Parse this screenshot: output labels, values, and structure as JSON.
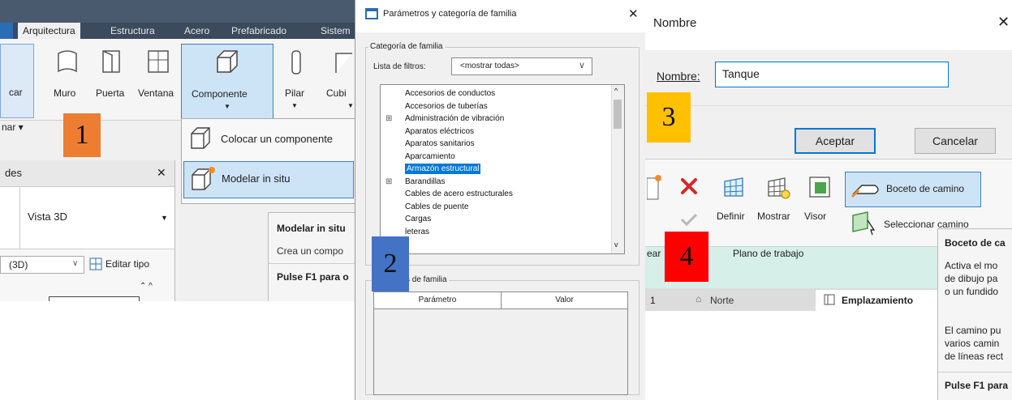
{
  "panel1": {
    "tabs": [
      "Arquitectura",
      "Estructura",
      "Acero",
      "Prefabricado",
      "Sistem"
    ],
    "left_edge_text": "car",
    "left_edge_text2": "nar ▾",
    "ribbon_buttons": [
      "Muro",
      "Puerta",
      "Ventana",
      "Componente",
      "Pilar",
      "Cubi"
    ],
    "menu": {
      "place_component": "Colocar un componente",
      "model_in_place": "Modelar in situ"
    },
    "tooltip": {
      "title": "Modelar in situ",
      "desc": "Crea un compo",
      "help": "Pulse F1 para o"
    },
    "properties": {
      "header": "des",
      "close": "✕",
      "view_name": "Vista 3D",
      "dropdown_value": "(3D)",
      "edit_type": "Editar tipo"
    },
    "badge": "1",
    "badge_color": "#ed7d31"
  },
  "panel2": {
    "title": "Parámetros y categoría de familia",
    "close": "✕",
    "group_category": "Categoría de familia",
    "filter_label": "Lista de filtros:",
    "filter_value": "<mostrar todas>",
    "categories": [
      {
        "label": "Accesorios de conductos",
        "expand": false
      },
      {
        "label": "Accesorios de tuberías",
        "expand": false
      },
      {
        "label": "Administración de vibración",
        "expand": true
      },
      {
        "label": "Aparatos eléctricos",
        "expand": false
      },
      {
        "label": "Aparatos sanitarios",
        "expand": false
      },
      {
        "label": "Aparcamiento",
        "expand": false
      },
      {
        "label": "Armazón estructural",
        "expand": false,
        "selected": true
      },
      {
        "label": "Barandillas",
        "expand": true
      },
      {
        "label": "Cables de acero estructurales",
        "expand": false
      },
      {
        "label": "Cables de puente",
        "expand": false
      },
      {
        "label": "Cargas",
        "expand": false
      },
      {
        "label": "leteras",
        "expand": false
      }
    ],
    "group_params": "s de familia",
    "col_param": "Parámetro",
    "col_value": "Valor",
    "badge": "2",
    "badge_color": "#4472c4"
  },
  "panel3": {
    "title": "Nombre",
    "close": "✕",
    "name_label": "Nombre:",
    "name_value": "Tanque",
    "ok": "Aceptar",
    "cancel": "Cancelar",
    "badge3": "3",
    "badge3_color": "#ffc000",
    "ribbon": {
      "define": "Definir",
      "show": "Mostrar",
      "viewer": "Visor",
      "sketch_path": "Boceto de camino",
      "select_path": "Seleccionar camino",
      "left_label": "ear",
      "work_plane": "Plano de trabajo",
      "row_num": "1",
      "north": "Norte",
      "site": "Emplazamiento"
    },
    "tooltip": {
      "title": "Boceto de ca",
      "line1": "Activa el mo",
      "line2": "de dibujo pa",
      "line3": "o un fundido",
      "line4": "El camino pu",
      "line5": "varios camin",
      "line6": "de líneas rect",
      "help": "Pulse F1 para"
    },
    "badge4": "4",
    "badge4_color": "#ff0000"
  }
}
